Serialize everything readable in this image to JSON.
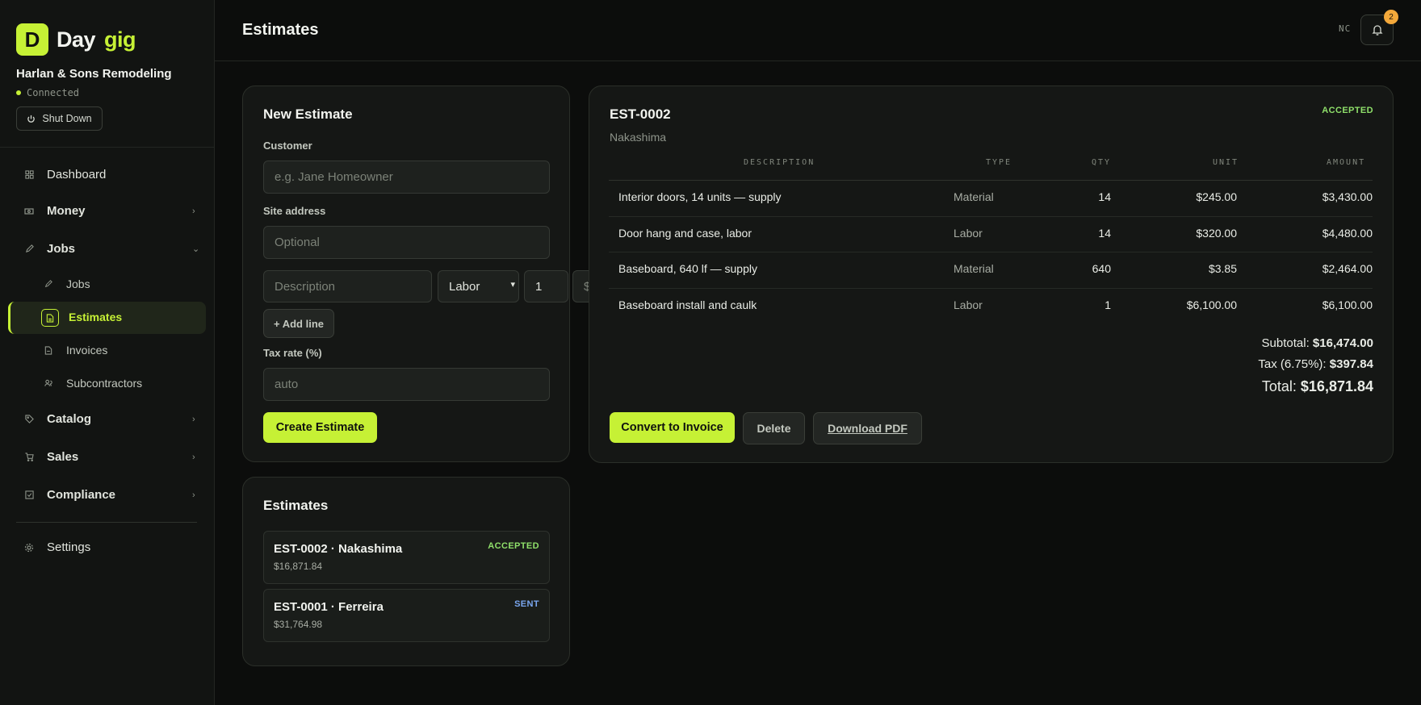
{
  "brand": {
    "logo_letter": "D",
    "name": "Day",
    "accent": "gig"
  },
  "company": "Harlan & Sons Remodeling",
  "connection": "Connected",
  "shutdown_label": "Shut Down",
  "nav": {
    "dashboard": "Dashboard",
    "money": "Money",
    "jobs": "Jobs",
    "jobs_sub": [
      "Jobs",
      "Estimates",
      "Invoices",
      "Subcontractors"
    ],
    "catalog": "Catalog",
    "sales": "Sales",
    "compliance": "Compliance",
    "settings": "Settings"
  },
  "header": {
    "title": "Estimates",
    "initials": "NC",
    "notifications": "2"
  },
  "new_estimate": {
    "title": "New Estimate",
    "customer_label": "Customer",
    "customer_placeholder": "e.g. Jane Homeowner",
    "site_label": "Site address",
    "site_placeholder": "Optional",
    "line_description_placeholder": "Description",
    "line_type": "Labor",
    "line_qty": "1",
    "line_unit_placeholder": "$",
    "add_line": "+ Add line",
    "tax_label": "Tax rate (%)",
    "tax_placeholder": "auto",
    "create": "Create Estimate"
  },
  "estimate": {
    "number": "EST-0002",
    "customer": "Nakashima",
    "status": "ACCEPTED",
    "columns": [
      "DESCRIPTION",
      "TYPE",
      "QTY",
      "UNIT",
      "AMOUNT"
    ],
    "lines": [
      {
        "description": "Interior doors, 14 units — supply",
        "type": "Material",
        "qty": "14",
        "unit": "$245.00",
        "amount": "$3,430.00"
      },
      {
        "description": "Door hang and case, labor",
        "type": "Labor",
        "qty": "14",
        "unit": "$320.00",
        "amount": "$4,480.00"
      },
      {
        "description": "Baseboard, 640 lf — supply",
        "type": "Material",
        "qty": "640",
        "unit": "$3.85",
        "amount": "$2,464.00"
      },
      {
        "description": "Baseboard install and caulk",
        "type": "Labor",
        "qty": "1",
        "unit": "$6,100.00",
        "amount": "$6,100.00"
      }
    ],
    "subtotal_label": "Subtotal:",
    "subtotal": "$16,474.00",
    "tax_label": "Tax (6.75%):",
    "tax": "$397.84",
    "total_label": "Total:",
    "total": "$16,871.84",
    "actions": {
      "convert": "Convert to Invoice",
      "delete": "Delete",
      "download": "Download PDF"
    }
  },
  "estimates_list": {
    "title": "Estimates",
    "items": [
      {
        "title": "EST-0002 · Nakashima",
        "amount": "$16,871.84",
        "status": "ACCEPTED"
      },
      {
        "title": "EST-0001 · Ferreira",
        "amount": "$31,764.98",
        "status": "SENT"
      }
    ]
  },
  "colors": {
    "accent": "#c6f135",
    "accepted": "#8fe06a",
    "sent": "#7aa7f0",
    "badge": "#f3a83a"
  }
}
